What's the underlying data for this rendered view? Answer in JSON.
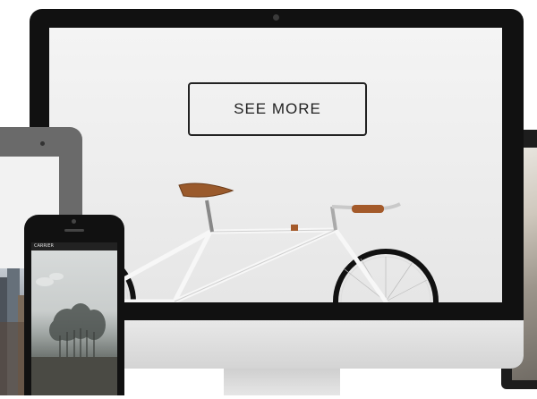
{
  "hero": {
    "cta_label": "SEE MORE"
  },
  "phone": {
    "carrier": "CARRIER"
  },
  "colors": {
    "device_frame": "#111111",
    "screen_background": "#ededed",
    "button_border": "#222222"
  },
  "icons": [
    "bicycle-illustration",
    "tree-illustration",
    "city-illustration"
  ]
}
